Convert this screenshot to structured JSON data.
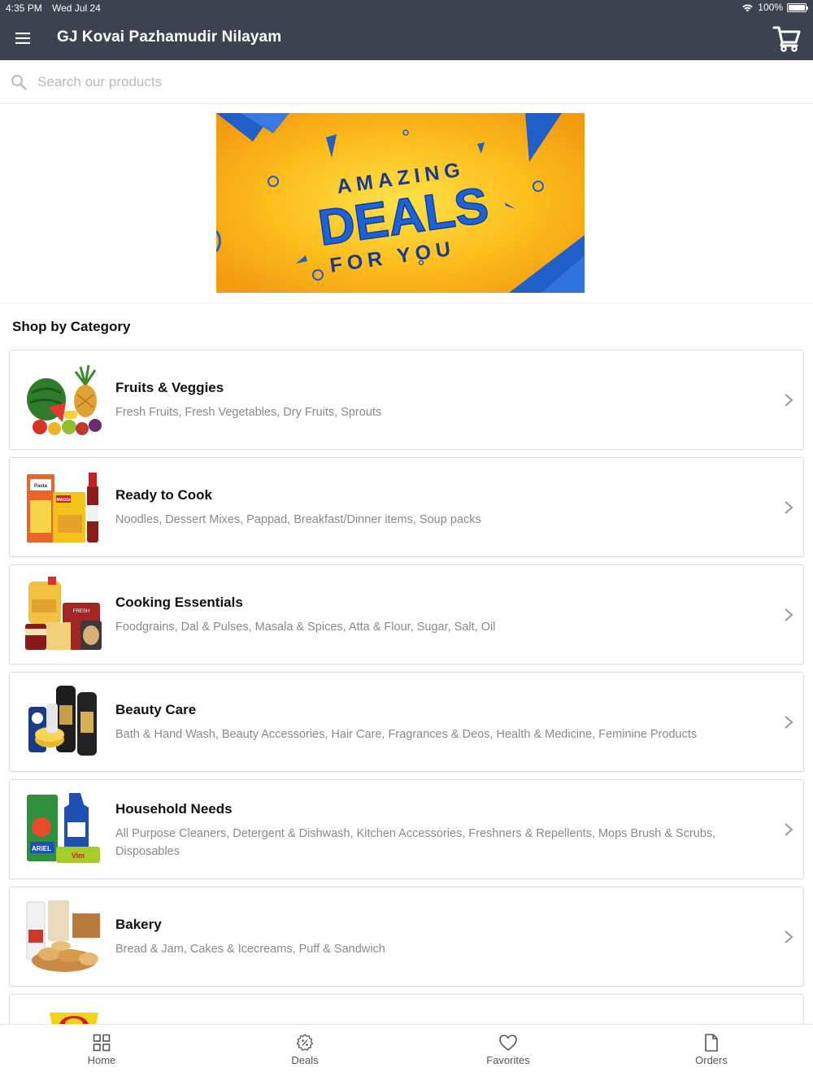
{
  "status_bar": {
    "time": "4:35 PM",
    "date": "Wed Jul 24",
    "battery": "100%"
  },
  "header": {
    "title": "GJ Kovai Pazhamudir Nilayam"
  },
  "search": {
    "placeholder": "Search our products"
  },
  "banner": {
    "line1": "AMAZING",
    "line2": "DEALS",
    "line3": "FOR YOU"
  },
  "section": {
    "title": "Shop by Category"
  },
  "categories": [
    {
      "title": "Fruits & Veggies",
      "subtitle": "Fresh Fruits, Fresh Vegetables, Dry Fruits, Sprouts"
    },
    {
      "title": "Ready to Cook",
      "subtitle": "Noodles, Dessert Mixes, Pappad, Breakfast/Dinner items, Soup packs"
    },
    {
      "title": "Cooking Essentials",
      "subtitle": "Foodgrains, Dal & Pulses, Masala & Spices, Atta & Flour, Sugar, Salt, Oil"
    },
    {
      "title": "Beauty Care",
      "subtitle": "Bath & Hand Wash, Beauty Accessories, Hair Care, Fragrances & Deos, Health & Medicine, Feminine Products"
    },
    {
      "title": "Household Needs",
      "subtitle": "All Purpose Cleaners, Detergent & Dishwash, Kitchen Accessories, Freshners & Repellents, Mops Brush & Scrubs, Disposables"
    },
    {
      "title": "Bakery",
      "subtitle": "Bread & Jam, Cakes & Icecreams, Puff & Sandwich"
    },
    {
      "title": "",
      "subtitle": ""
    }
  ],
  "tabs": [
    {
      "label": "Home",
      "icon": "grid-icon"
    },
    {
      "label": "Deals",
      "icon": "deals-badge-icon"
    },
    {
      "label": "Favorites",
      "icon": "heart-icon"
    },
    {
      "label": "Orders",
      "icon": "document-icon"
    }
  ],
  "colors": {
    "header_bg": "#3c4250",
    "banner_yellow": "#f7b217",
    "banner_blue": "#1f5fc7"
  }
}
